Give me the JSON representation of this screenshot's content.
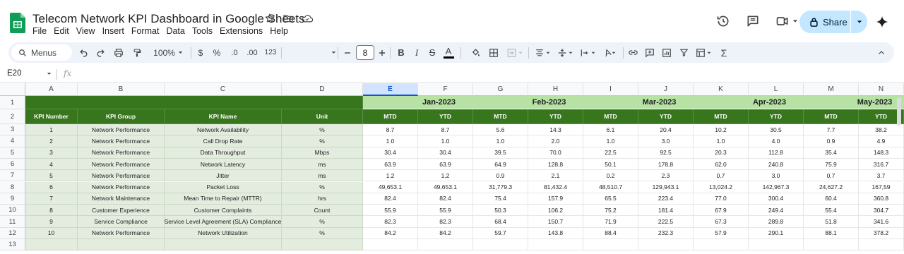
{
  "app": {
    "doc_title": "Telecom Network KPI Dashboard in Google Sheets",
    "menu": [
      "File",
      "Edit",
      "View",
      "Insert",
      "Format",
      "Data",
      "Tools",
      "Extensions",
      "Help"
    ],
    "share_label": "Share",
    "brand_color": "#0f9d58",
    "share_color": "#c2e7ff"
  },
  "toolbar": {
    "menus_label": "Menus",
    "zoom": "100%",
    "currency": "$",
    "percent": "%",
    "dec_less": ".0",
    "dec_more": ".00",
    "number_format": "123",
    "font_size": "8",
    "bold": "B",
    "italic": "I",
    "strike": "S",
    "text_color": "A",
    "text_rotation": "A",
    "function": "Σ"
  },
  "formula_bar": {
    "name_box": "E20",
    "fx": "fx"
  },
  "sheet": {
    "columns": [
      "A",
      "B",
      "C",
      "D",
      "E",
      "F",
      "G",
      "H",
      "I",
      "J",
      "K",
      "L",
      "M",
      "N"
    ],
    "rows": [
      "1",
      "2",
      "3",
      "4",
      "5",
      "6",
      "7",
      "8",
      "9",
      "10",
      "11",
      "12",
      "13"
    ],
    "months": [
      "Jan-2023",
      "Feb-2023",
      "Mar-2023",
      "Apr-2023",
      "May-2023"
    ],
    "headers": {
      "kpi_number": "KPI Number",
      "kpi_group": "KPI Group",
      "kpi_name": "KPI Name",
      "unit": "Unit",
      "mtd": "MTD",
      "ytd": "YTD"
    },
    "colors": {
      "dark_header": "#38761d",
      "month_header": "#b6e3a4",
      "light_fill": "#e3ecdf",
      "selected_col": "#d3e3fd"
    },
    "data_rows": [
      {
        "num": "1",
        "group": "Network Performance",
        "name": "Network Availability",
        "unit": "%",
        "vals": [
          "8.7",
          "8.7",
          "5.6",
          "14.3",
          "6.1",
          "20.4",
          "10.2",
          "30.5",
          "7.7",
          "38.2"
        ]
      },
      {
        "num": "2",
        "group": "Network Performance",
        "name": "Call Drop Rate",
        "unit": "%",
        "vals": [
          "1.0",
          "1.0",
          "1.0",
          "2.0",
          "1.0",
          "3.0",
          "1.0",
          "4.0",
          "0.9",
          "4.9"
        ]
      },
      {
        "num": "3",
        "group": "Network Performance",
        "name": "Data Throughput",
        "unit": "Mbps",
        "vals": [
          "30.4",
          "30.4",
          "39.5",
          "70.0",
          "22.5",
          "92.5",
          "20.3",
          "112.8",
          "35.4",
          "148.3"
        ]
      },
      {
        "num": "4",
        "group": "Network Performance",
        "name": "Network Latency",
        "unit": "ms",
        "vals": [
          "63.9",
          "63.9",
          "64.9",
          "128.8",
          "50.1",
          "178.8",
          "62.0",
          "240.8",
          "75.9",
          "316.7"
        ]
      },
      {
        "num": "5",
        "group": "Network Performance",
        "name": "Jitter",
        "unit": "ms",
        "vals": [
          "1.2",
          "1.2",
          "0.9",
          "2.1",
          "0.2",
          "2.3",
          "0.7",
          "3.0",
          "0.7",
          "3.7"
        ]
      },
      {
        "num": "6",
        "group": "Network Performance",
        "name": "Packet Loss",
        "unit": "%",
        "vals": [
          "49,653.1",
          "49,653.1",
          "31,779.3",
          "81,432.4",
          "48,510.7",
          "129,943.1",
          "13,024.2",
          "142,967.3",
          "24,627.2",
          "167,59"
        ]
      },
      {
        "num": "7",
        "group": "Network Maintenance",
        "name": "Mean Time to Repair (MTTR)",
        "unit": "hrs",
        "vals": [
          "82.4",
          "82.4",
          "75.4",
          "157.9",
          "65.5",
          "223.4",
          "77.0",
          "300.4",
          "60.4",
          "360.8"
        ]
      },
      {
        "num": "8",
        "group": "Customer Experience",
        "name": "Customer Complaints",
        "unit": "Count",
        "vals": [
          "55.9",
          "55.9",
          "50.3",
          "106.2",
          "75.2",
          "181.4",
          "67.9",
          "249.4",
          "55.4",
          "304.7"
        ]
      },
      {
        "num": "9",
        "group": "Service Compliance",
        "name": "Service Level Agreement (SLA) Compliance",
        "unit": "%",
        "vals": [
          "82.3",
          "82.3",
          "68.4",
          "150.7",
          "71.9",
          "222.5",
          "67.3",
          "289.8",
          "51.8",
          "341.6"
        ]
      },
      {
        "num": "10",
        "group": "Network Performance",
        "name": "Network Utilization",
        "unit": "%",
        "vals": [
          "84.2",
          "84.2",
          "59.7",
          "143.8",
          "88.4",
          "232.3",
          "57.9",
          "290.1",
          "88.1",
          "378.2"
        ]
      }
    ]
  }
}
